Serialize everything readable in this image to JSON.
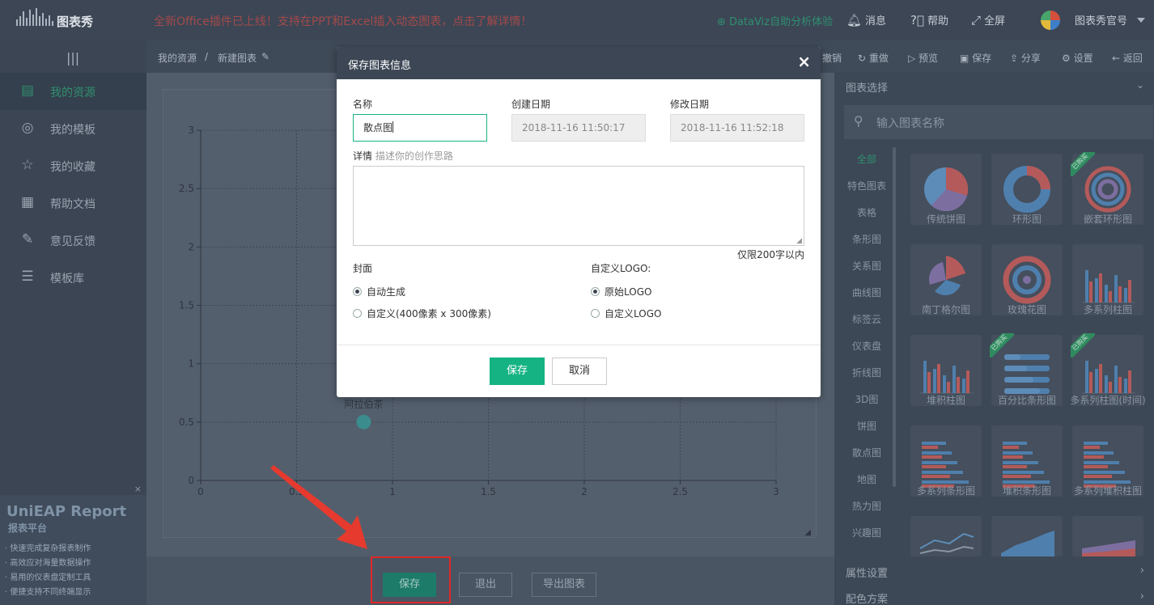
{
  "topbar": {
    "logo_text": "图表秀",
    "notice": "全新Office插件已上线！支持在PPT和Excel插入动态图表，点击了解详情！",
    "datav": "DataViz自助分析体验",
    "messages": "消息",
    "help": "帮助",
    "fullscreen": "全屏",
    "account": "图表秀官号"
  },
  "sidebar": {
    "items": [
      {
        "label": "我的资源",
        "icon": "document-icon"
      },
      {
        "label": "我的模板",
        "icon": "target-icon"
      },
      {
        "label": "我的收藏",
        "icon": "star-icon"
      },
      {
        "label": "帮助文档",
        "icon": "doc-list-icon"
      },
      {
        "label": "意见反馈",
        "icon": "feedback-icon"
      },
      {
        "label": "模板库",
        "icon": "template-icon"
      }
    ],
    "promo": {
      "title": "UniEAP Report",
      "subtitle": "报表平台",
      "features": [
        "快速完成复杂报表制作",
        "高效应对海量数据操作",
        "易用的仪表盘定制工具",
        "便捷支持不同终端显示"
      ]
    }
  },
  "breadcrumb": {
    "root": "我的资源",
    "sep": "/",
    "current": "新建图表"
  },
  "toolbar": {
    "undo": "撤销",
    "redo": "重做",
    "preview": "预览",
    "save": "保存",
    "share": "分享",
    "settings": "设置",
    "back": "返回"
  },
  "chart_data": {
    "type": "scatter",
    "xlim": [
      0,
      3
    ],
    "ylim": [
      0,
      3
    ],
    "x_ticks": [
      "0",
      "0.5",
      "1",
      "1.5",
      "2",
      "2.5",
      "3"
    ],
    "y_ticks": [
      "0",
      "0.5",
      "1",
      "1.5",
      "2",
      "2.5",
      "3"
    ],
    "grid": true,
    "points": [
      {
        "x": 0.85,
        "y": 0.5,
        "label": "阿拉伯茶"
      }
    ]
  },
  "bottom": {
    "save": "保存",
    "exit": "退出",
    "export": "导出图表"
  },
  "right_panel": {
    "header": "图表选择",
    "search_placeholder": "输入图表名称",
    "categories": [
      "全部",
      "特色图表",
      "表格",
      "条形图",
      "关系图",
      "曲线图",
      "标签云",
      "仪表盘",
      "折线图",
      "3D图",
      "饼图",
      "散点图",
      "地图",
      "热力图",
      "兴趣图"
    ],
    "charts": [
      {
        "label": "传统饼图",
        "badge": ""
      },
      {
        "label": "环形图",
        "badge": ""
      },
      {
        "label": "嵌套环形图",
        "badge": "已购买"
      },
      {
        "label": "南丁格尔图",
        "badge": ""
      },
      {
        "label": "玫瑰花图",
        "badge": ""
      },
      {
        "label": "多系列柱图",
        "badge": ""
      },
      {
        "label": "堆积柱图",
        "badge": ""
      },
      {
        "label": "百分比条形图",
        "badge": "已购买"
      },
      {
        "label": "多系列柱图(时间)",
        "badge": "已购买"
      },
      {
        "label": "多系列条形图",
        "badge": ""
      },
      {
        "label": "堆积条形图",
        "badge": ""
      },
      {
        "label": "多系列堆积柱图",
        "badge": ""
      }
    ],
    "attr_settings": "属性设置",
    "color_scheme": "配色方案"
  },
  "modal": {
    "title": "保存图表信息",
    "name_label": "名称",
    "name_value": "散点图",
    "created_label": "创建日期",
    "created_value": "2018-11-16 11:50:17",
    "modified_label": "修改日期",
    "modified_value": "2018-11-16 11:52:18",
    "detail_label": "详情",
    "detail_hint": "描述你的创作思路",
    "limit": "仅限200字以内",
    "cover_label": "封面",
    "cover_auto": "自动生成",
    "cover_custom": "自定义(400像素 x 300像素)",
    "logo_label": "自定义LOGO:",
    "logo_original": "原始LOGO",
    "logo_custom": "自定义LOGO",
    "save": "保存",
    "cancel": "取消"
  }
}
